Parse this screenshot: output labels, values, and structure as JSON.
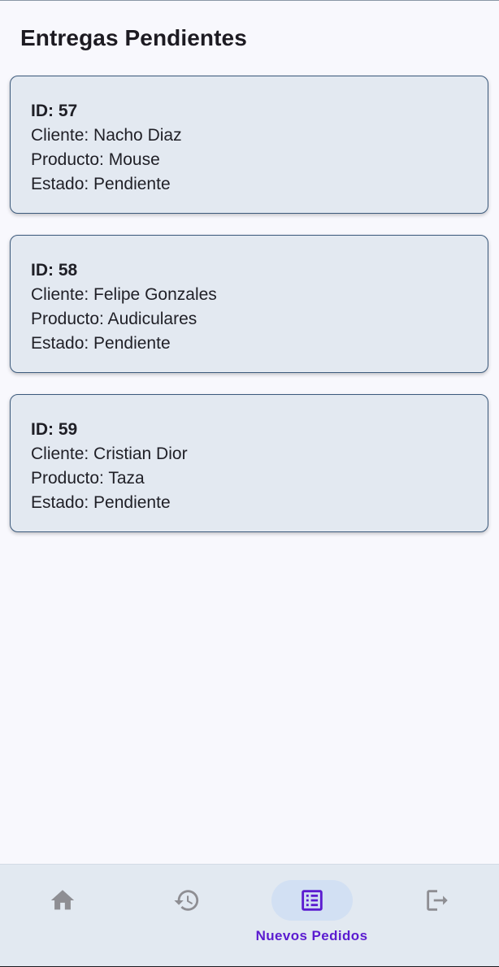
{
  "header": {
    "title": "Entregas Pendientes"
  },
  "orders": [
    {
      "id": "ID: 57",
      "cliente": "Cliente: Nacho Diaz",
      "producto": "Producto: Mouse",
      "estado": "Estado: Pendiente"
    },
    {
      "id": "ID: 58",
      "cliente": "Cliente: Felipe Gonzales",
      "producto": "Producto: Audiculares",
      "estado": "Estado: Pendiente"
    },
    {
      "id": "ID: 59",
      "cliente": "Cliente: Cristian Dior",
      "producto": "Producto: Taza",
      "estado": "Estado: Pendiente"
    }
  ],
  "nav": {
    "items": [
      {
        "icon": "home-icon",
        "label": ""
      },
      {
        "icon": "history-icon",
        "label": ""
      },
      {
        "icon": "list-icon",
        "label": "Nuevos Pedidos",
        "active": true
      },
      {
        "icon": "logout-icon",
        "label": ""
      }
    ],
    "active_color": "#5b1bd0",
    "inactive_color": "#8e8e93"
  }
}
